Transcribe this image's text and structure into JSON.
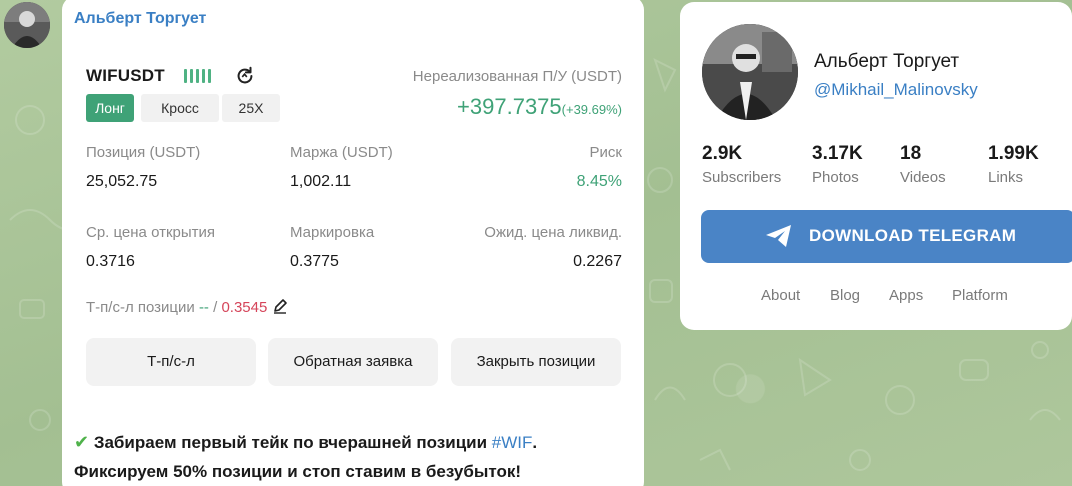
{
  "channel": {
    "author": "Альберт Торгует"
  },
  "trade": {
    "ticker": "WIFUSDT",
    "tags": {
      "side": "Лонг",
      "margin_mode": "Кросс",
      "leverage": "25X"
    },
    "pnl_label": "Нереализованная П/У (USDT)",
    "pnl_value": "+397.7375",
    "pnl_percent": "(+39.69%)",
    "position_label": "Позиция (USDT)",
    "position_value": "25,052.75",
    "margin_label": "Маржа (USDT)",
    "margin_value": "1,002.11",
    "risk_label": "Риск",
    "risk_value": "8.45%",
    "entry_label": "Ср. цена открытия",
    "entry_value": "0.3716",
    "mark_label": "Маркировка",
    "mark_value": "0.3775",
    "liq_label": "Ожид. цена ликвид.",
    "liq_value": "0.2267",
    "tpsl_label": "Т-п/с-л позиции",
    "tpsl_tp": "--",
    "tpsl_sep": "/",
    "tpsl_sl": "0.3545",
    "buttons": {
      "tpsl": "Т-п/с-л",
      "reverse": "Обратная заявка",
      "close": "Закрыть позиции"
    }
  },
  "message": {
    "check": "✔",
    "line1": "Забираем первый тейк по вчерашней позиции",
    "hashtag": "#WIF",
    "line1_end": ".",
    "line2": "Фиксируем 50% позиции и стоп ставим в безубыток!"
  },
  "profile": {
    "name": "Альберт Торгует",
    "username": "@Mikhail_Malinovsky",
    "stats": [
      {
        "num": "2.9K",
        "cap": "Subscribers"
      },
      {
        "num": "3.17K",
        "cap": "Photos"
      },
      {
        "num": "18",
        "cap": "Videos"
      },
      {
        "num": "1.99K",
        "cap": "Links"
      }
    ],
    "download_label": "DOWNLOAD TELEGRAM",
    "links": [
      "About",
      "Blog",
      "Apps",
      "Platform"
    ]
  },
  "colors": {
    "accent": "#3a7fc4",
    "green": "#3fa277",
    "red": "#d5455a",
    "download_bg": "#4a84c6",
    "background": "#a9c39a"
  },
  "icons": [
    "refresh-icon",
    "pencil-icon",
    "checkmark-icon",
    "telegram-plane-icon"
  ]
}
